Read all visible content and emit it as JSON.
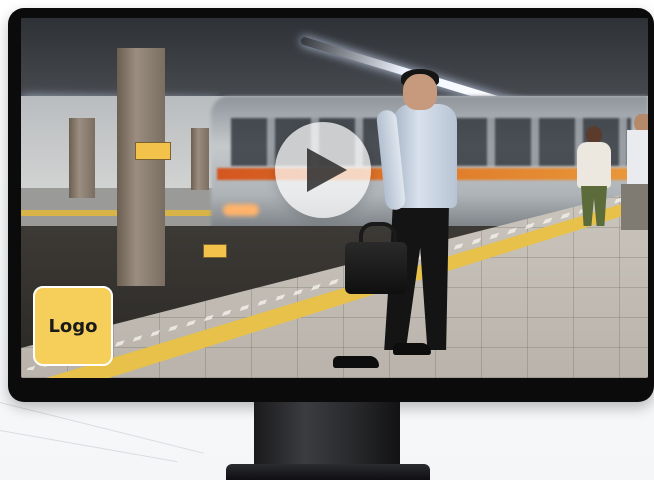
{
  "window": {
    "title": ""
  },
  "video": {
    "play_icon": "play-icon",
    "scene": "train-station-platform"
  },
  "logo": {
    "text": "Logo",
    "color": "#f6cf5b"
  },
  "colors": {
    "monitor_bezel": "#0b0b0c",
    "logo_badge": "#f6cf5b",
    "play_overlay": "rgba(255,255,255,0.72)"
  }
}
